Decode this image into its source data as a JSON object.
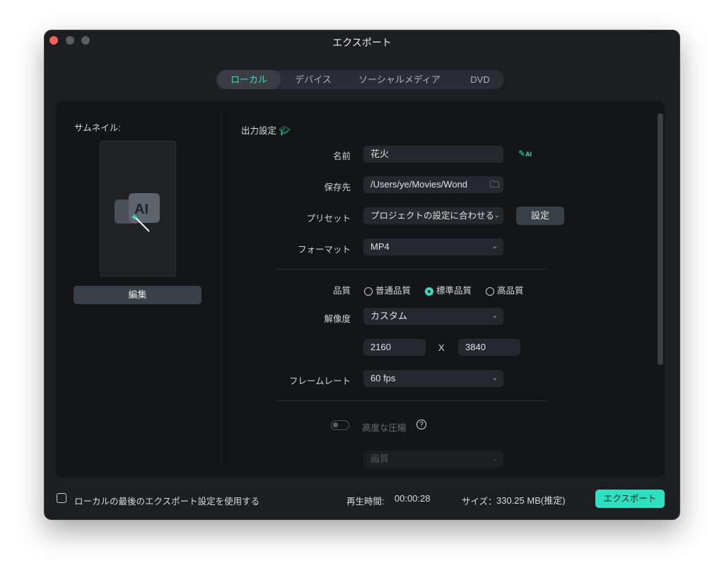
{
  "window": {
    "title": "エクスポート"
  },
  "tabs": [
    {
      "label": "ローカル",
      "active": true
    },
    {
      "label": "デバイス"
    },
    {
      "label": "ソーシャルメディア"
    },
    {
      "label": "DVD"
    }
  ],
  "thumbnail": {
    "label": "サムネイル:",
    "edit_label": "編集"
  },
  "output": {
    "heading": "出力設定",
    "name_label": "名前",
    "name_value": "花火",
    "ai_badge": "AI",
    "save_label": "保存先",
    "save_value": "/Users/ye/Movies/Wond",
    "preset_label": "プリセット",
    "preset_value": "プロジェクトの設定に合わせる",
    "preset_button": "設定",
    "format_label": "フォーマット",
    "format_value": "MP4",
    "quality_label": "品質",
    "quality_options": [
      "普通品質",
      "標準品質",
      "高品質"
    ],
    "quality_selected": "標準品質",
    "resolution_label": "解像度",
    "resolution_value": "カスタム",
    "width": "2160",
    "x_sep": "X",
    "height": "3840",
    "framerate_label": "フレームレート",
    "framerate_value": "60 fps",
    "compression_label": "高度な圧縮",
    "compression_on": false,
    "help": "?",
    "compression_mode": "画質"
  },
  "footer": {
    "use_last_label": "ローカルの最後のエクスポート設定を使用する",
    "duration_label": "再生時間:",
    "duration_value": "00:00:28",
    "size_label": "サイズ：",
    "size_value": "330.25 MB(推定)",
    "export_label": "エクスポート"
  },
  "colors": {
    "accent": "#2fe0c0",
    "close": "#ff5f57"
  }
}
